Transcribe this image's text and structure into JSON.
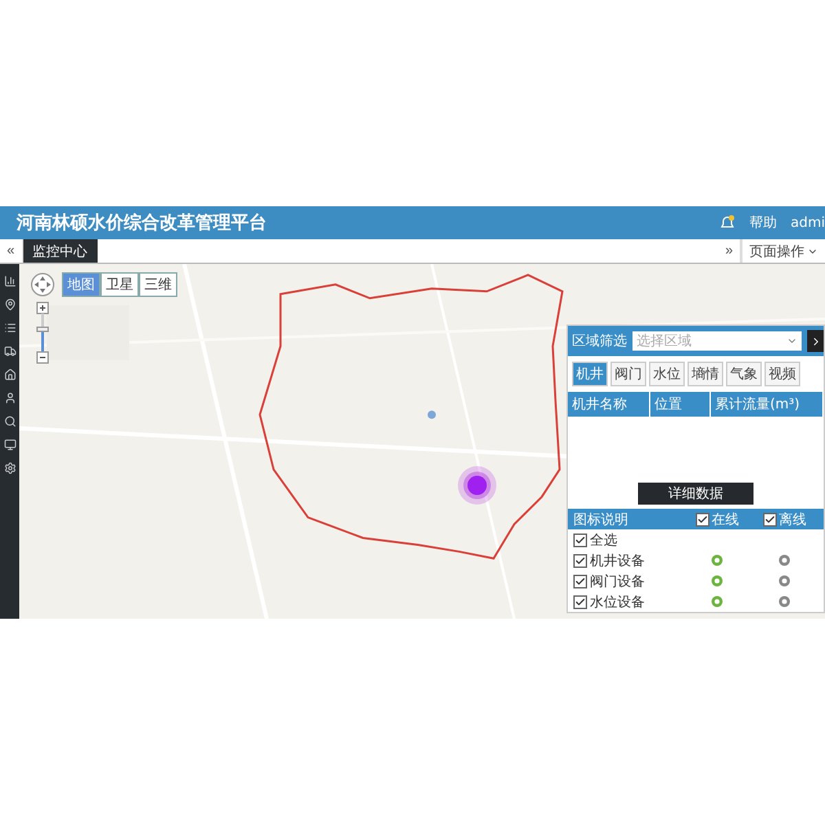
{
  "header": {
    "title": "河南林硕水价综合改革管理平台",
    "help": "帮助",
    "user": "admi"
  },
  "tab_bar": {
    "back": "«",
    "tabs": [
      {
        "label": "监控中心",
        "selected": true
      }
    ],
    "forward": "»",
    "page_actions": "页面操作"
  },
  "map": {
    "map_types": [
      {
        "label": "地图",
        "selected": true
      },
      {
        "label": "卫星",
        "selected": false
      },
      {
        "label": "三维",
        "selected": false
      }
    ]
  },
  "panel": {
    "filter_label": "区域筛选",
    "filter_placeholder": "选择区域",
    "device_tabs": [
      {
        "label": "机井",
        "selected": true
      },
      {
        "label": "阀门",
        "selected": false
      },
      {
        "label": "水位",
        "selected": false
      },
      {
        "label": "墒情",
        "selected": false
      },
      {
        "label": "气象",
        "selected": false
      },
      {
        "label": "视频",
        "selected": false
      }
    ],
    "columns": [
      "机井名称",
      "位置",
      "累计流量(m³)"
    ],
    "detail_button": "详细数据",
    "legend": {
      "title": "图标说明",
      "status_filters": [
        {
          "label": "在线",
          "checked": true
        },
        {
          "label": "离线",
          "checked": true
        }
      ],
      "select_all": {
        "label": "全选",
        "checked": true
      },
      "devices": [
        {
          "label": "机井设备",
          "checked": true
        },
        {
          "label": "阀门设备",
          "checked": true
        },
        {
          "label": "水位设备",
          "checked": true
        }
      ]
    }
  }
}
